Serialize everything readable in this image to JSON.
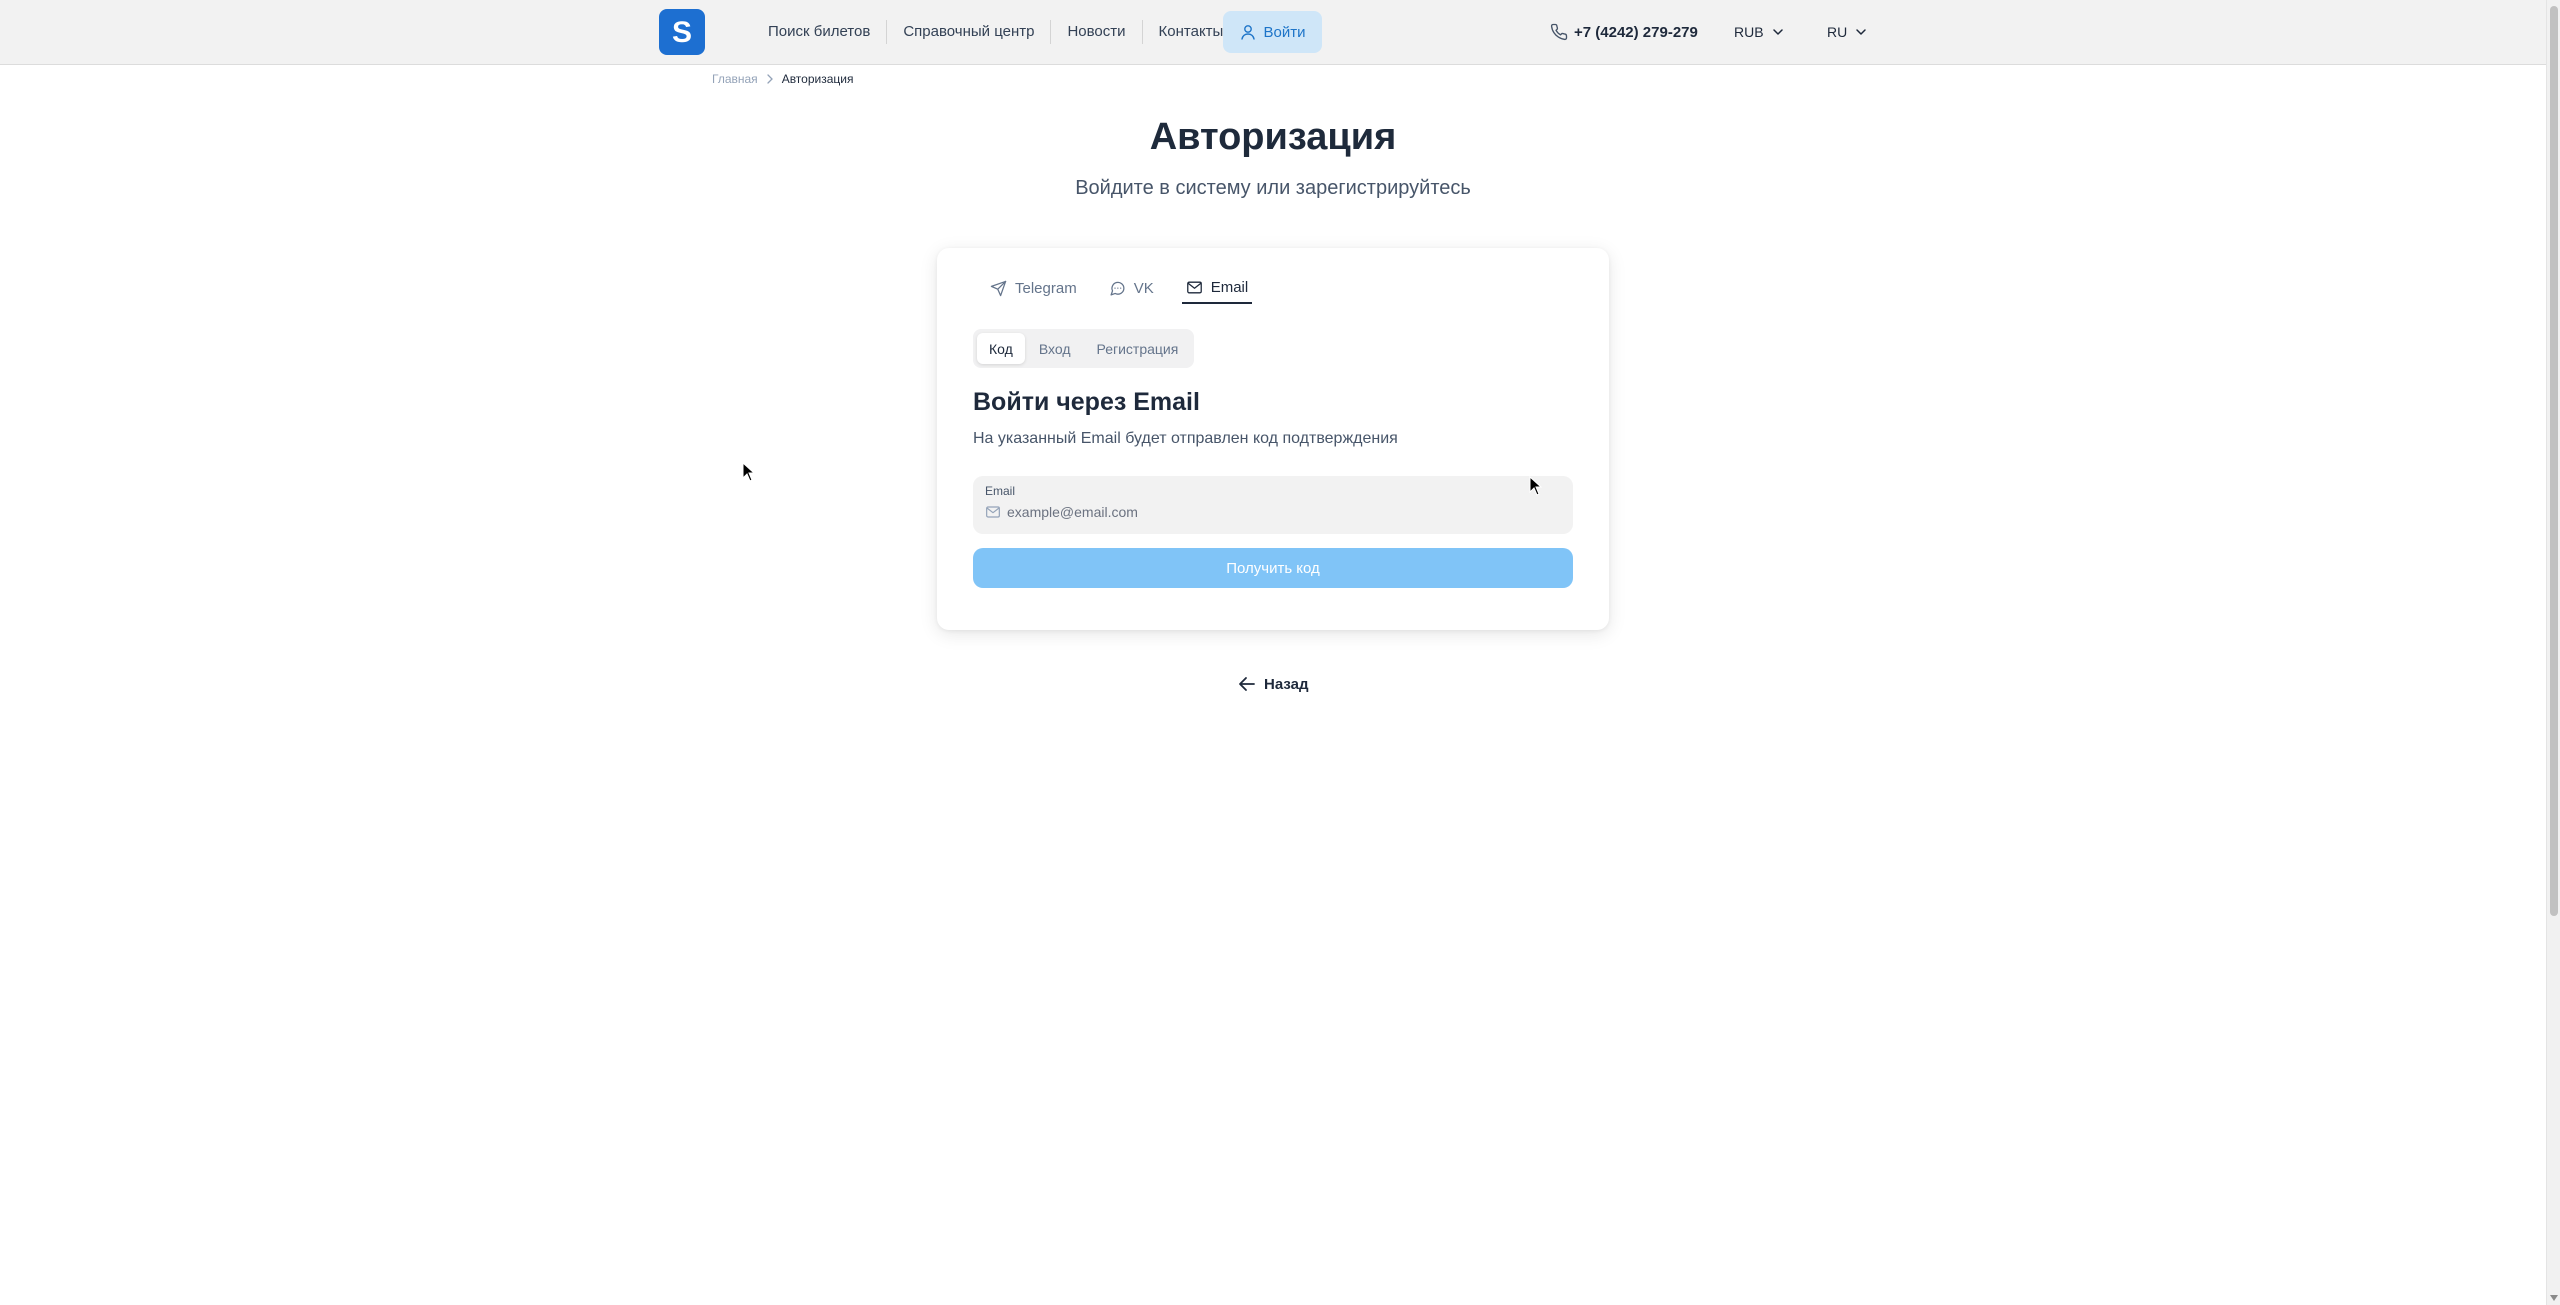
{
  "header": {
    "logo_letter": "S",
    "nav": [
      {
        "label": "Поиск билетов"
      },
      {
        "label": "Справочный центр"
      },
      {
        "label": "Новости"
      },
      {
        "label": "Контакты"
      }
    ],
    "login_label": "Войти",
    "phone": "+7 (4242) 279-279",
    "currency": "RUB",
    "language": "RU"
  },
  "breadcrumb": {
    "home": "Главная",
    "current": "Авторизация"
  },
  "page": {
    "title": "Авторизация",
    "subtitle": "Войдите в систему или зарегистрируйтесь"
  },
  "card": {
    "method_tabs": [
      {
        "label": "Telegram",
        "icon": "send-icon"
      },
      {
        "label": "VK",
        "icon": "chat-bubble-icon"
      },
      {
        "label": "Email",
        "icon": "mail-icon",
        "active": true
      }
    ],
    "sub_tabs": [
      {
        "label": "Код",
        "active": true
      },
      {
        "label": "Вход"
      },
      {
        "label": "Регистрация"
      }
    ],
    "title": "Войти через Email",
    "description": "На указанный Email будет отправлен код подтверждения",
    "email_label": "Email",
    "email_placeholder": "example@email.com",
    "email_value": "",
    "submit_label": "Получить код"
  },
  "back_label": "Назад",
  "colors": {
    "brand": "#1d6fd1",
    "login_bg": "#cfe6f8",
    "login_text": "#1d74c8",
    "submit_bg": "#80c4f7"
  }
}
